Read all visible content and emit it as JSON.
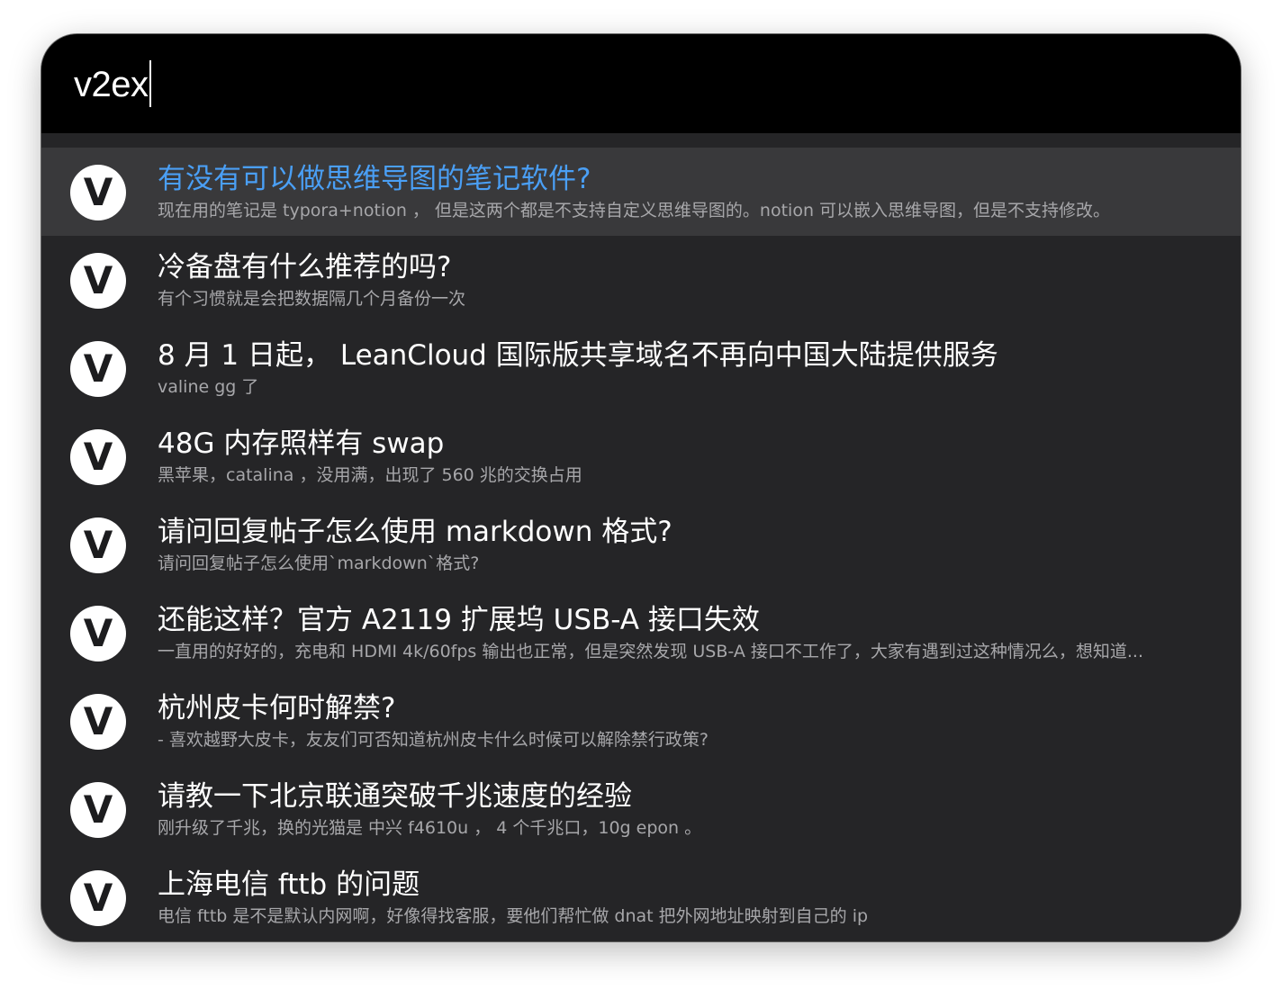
{
  "search": {
    "query": "v2ex"
  },
  "colors": {
    "selected_title": "#4a9ff5",
    "window_bg": "#252527",
    "search_bg": "#000000"
  },
  "results": [
    {
      "icon": "v2ex-logo-icon",
      "avatar_letter": "V",
      "title": "有没有可以做思维导图的笔记软件?",
      "subtitle": "现在用的笔记是 typora+notion ， 但是这两个都是不支持自定义思维导图的。notion 可以嵌入思维导图，但是不支持修改。",
      "selected": true
    },
    {
      "icon": "v2ex-logo-icon",
      "avatar_letter": "V",
      "title": "冷备盘有什么推荐的吗?",
      "subtitle": "有个习惯就是会把数据隔几个月备份一次"
    },
    {
      "icon": "v2ex-logo-icon",
      "avatar_letter": "V",
      "title": "8 月 1 日起， LeanCloud 国际版共享域名不再向中国大陆提供服务",
      "subtitle": "valine gg 了"
    },
    {
      "icon": "v2ex-logo-icon",
      "avatar_letter": "V",
      "title": "48G 内存照样有 swap",
      "subtitle": "黑苹果，catalina ，没用满，出现了 560 兆的交换占用"
    },
    {
      "icon": "v2ex-logo-icon",
      "avatar_letter": "V",
      "title": "请问回复帖子怎么使用 markdown 格式?",
      "subtitle": "请问回复帖子怎么使用`markdown`格式?"
    },
    {
      "icon": "v2ex-logo-icon",
      "avatar_letter": "V",
      "title": "还能这样？官方 A2119 扩展坞 USB-A 接口失效",
      "subtitle": "一直用的好好的，充电和 HDMI 4k/60fps 输出也正常，但是突然发现 USB-A 接口不工作了，大家有遇到过这种情况么，想知道..."
    },
    {
      "icon": "v2ex-logo-icon",
      "avatar_letter": "V",
      "title": "杭州皮卡何时解禁?",
      "subtitle": "- 喜欢越野大皮卡，友友们可否知道杭州皮卡什么时候可以解除禁行政策?"
    },
    {
      "icon": "v2ex-logo-icon",
      "avatar_letter": "V",
      "title": "请教一下北京联通突破千兆速度的经验",
      "subtitle": "刚升级了千兆，换的光猫是 中兴 f4610u ， 4 个千兆口，10g epon 。"
    },
    {
      "icon": "v2ex-logo-icon",
      "avatar_letter": "V",
      "title": "上海电信 fttb 的问题",
      "subtitle": "电信 fttb 是不是默认内网啊，好像得找客服，要他们帮忙做 dnat 把外网地址映射到自己的 ip"
    }
  ]
}
